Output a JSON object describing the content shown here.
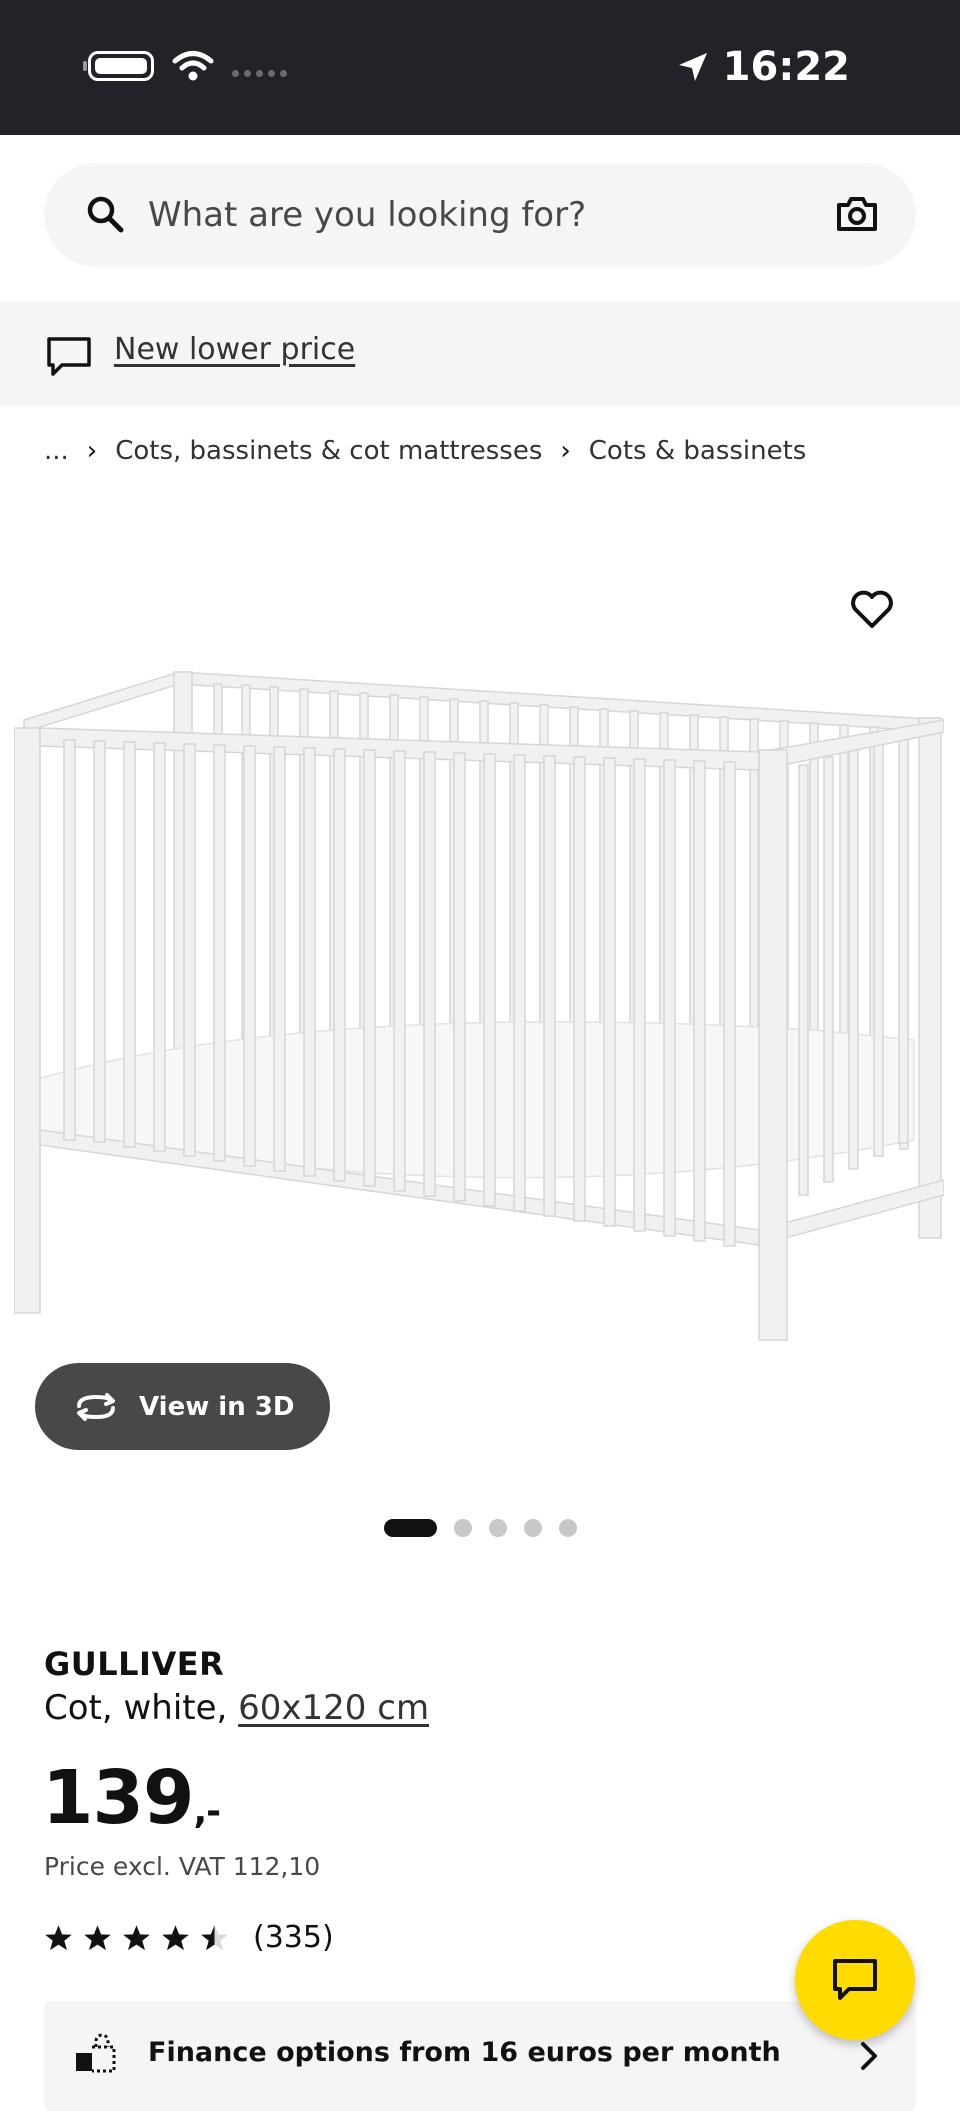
{
  "status_bar": {
    "time": "16:22"
  },
  "search": {
    "placeholder": "What are you looking for?"
  },
  "promo": {
    "label": "New lower price"
  },
  "breadcrumb": {
    "ellipsis": "...",
    "separator": "›",
    "items": [
      "Cots, bassinets & cot mattresses",
      "Cots & bassinets"
    ]
  },
  "gallery": {
    "view3d_label": "View in 3D",
    "pager_count": 5,
    "pager_active": 1
  },
  "product": {
    "name": "GULLIVER",
    "description": "Cot, white, ",
    "size": "60x120 cm",
    "price_main": "139",
    "price_suffix": ",-",
    "vat_text": "Price excl. VAT 112,10",
    "rating_value": 4.5,
    "rating_max": 5,
    "rating_count": "(335)"
  },
  "finance": {
    "label": "Finance options from 16 euros per month"
  },
  "colors": {
    "dark": "#222328",
    "search_bg": "#f5f5f5",
    "chat_fab": "#ffdb00",
    "button_dark": "#484848"
  },
  "icons": [
    "search-icon",
    "camera-icon",
    "chat-bubble-icon",
    "heart-icon",
    "rotate-3d-icon",
    "star-icon",
    "finance-icon",
    "chevron-right-icon",
    "location-arrow-icon",
    "wifi-icon",
    "battery-icon"
  ]
}
